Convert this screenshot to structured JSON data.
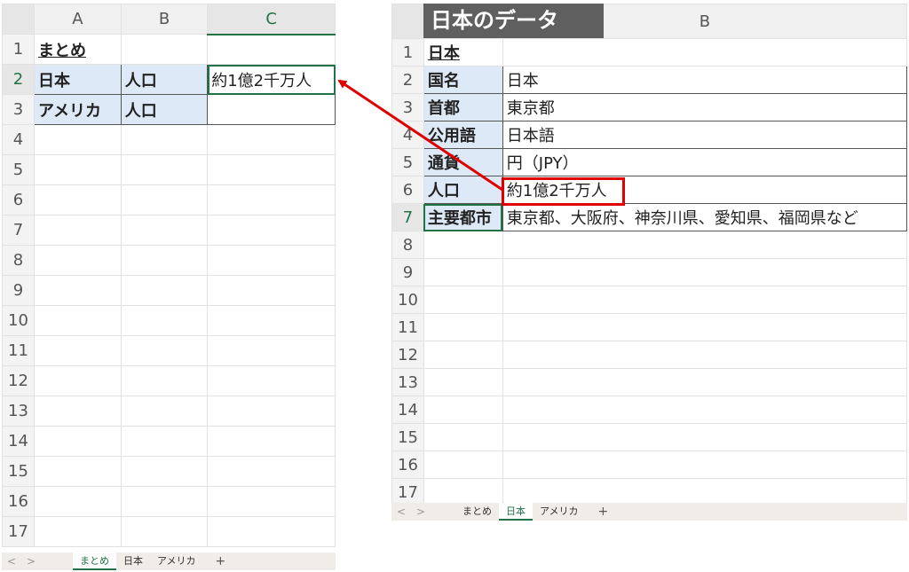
{
  "left_sheet": {
    "columns": [
      "A",
      "B",
      "C"
    ],
    "rows": [
      {
        "num": "1",
        "a": "まとめ",
        "b": "",
        "c": ""
      },
      {
        "num": "2",
        "a": "日本",
        "b": "人口",
        "c": "約1億2千万人"
      },
      {
        "num": "3",
        "a": "アメリカ",
        "b": "人口",
        "c": ""
      },
      {
        "num": "4"
      },
      {
        "num": "5"
      },
      {
        "num": "6"
      },
      {
        "num": "7"
      },
      {
        "num": "8"
      },
      {
        "num": "9"
      },
      {
        "num": "10"
      },
      {
        "num": "11"
      },
      {
        "num": "12"
      },
      {
        "num": "13"
      },
      {
        "num": "14"
      },
      {
        "num": "15"
      },
      {
        "num": "16"
      },
      {
        "num": "17"
      }
    ],
    "tabs": [
      "まとめ",
      "日本",
      "アメリカ"
    ],
    "active_tab": "まとめ",
    "add_tab": "+"
  },
  "right_sheet": {
    "banner": "日本のデータ",
    "column_b": "B",
    "rows": [
      {
        "num": "1",
        "a": "日本",
        "b": ""
      },
      {
        "num": "2",
        "a": "国名",
        "b": "日本"
      },
      {
        "num": "3",
        "a": "首都",
        "b": "東京都"
      },
      {
        "num": "4",
        "a": "公用語",
        "b": "日本語"
      },
      {
        "num": "5",
        "a": "通貨",
        "b": "円（JPY）"
      },
      {
        "num": "6",
        "a": "人口",
        "b": "約1億2千万人"
      },
      {
        "num": "7",
        "a": "主要都市",
        "b": "東京都、大阪府、神奈川県、愛知県、福岡県など"
      },
      {
        "num": "8"
      },
      {
        "num": "9"
      },
      {
        "num": "10"
      },
      {
        "num": "11"
      },
      {
        "num": "12"
      },
      {
        "num": "13"
      },
      {
        "num": "14"
      },
      {
        "num": "15"
      },
      {
        "num": "16"
      },
      {
        "num": "17"
      }
    ],
    "tabs": [
      "まとめ",
      "日本",
      "アメリカ"
    ],
    "active_tab": "日本",
    "add_tab": "+"
  },
  "nav": {
    "prev": "<",
    "next": ">"
  },
  "colors": {
    "accent": "#217346",
    "highlight": "#e00000",
    "label_fill": "#dde9f6"
  }
}
